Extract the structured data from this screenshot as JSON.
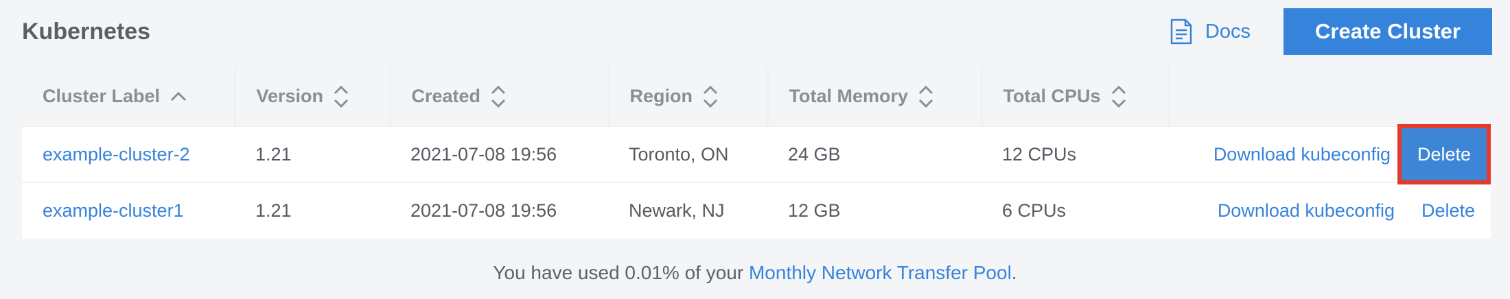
{
  "header": {
    "title": "Kubernetes",
    "docs_label": "Docs",
    "create_label": "Create Cluster"
  },
  "table": {
    "columns": [
      {
        "label": "Cluster Label",
        "sort": "ascending"
      },
      {
        "label": "Version",
        "sort": "none"
      },
      {
        "label": "Created",
        "sort": "none"
      },
      {
        "label": "Region",
        "sort": "none"
      },
      {
        "label": "Total Memory",
        "sort": "none"
      },
      {
        "label": "Total CPUs",
        "sort": "none"
      },
      {
        "label": "",
        "sort": "none"
      }
    ],
    "rows": [
      {
        "label": "example-cluster-2",
        "version": "1.21",
        "created": "2021-07-08 19:56",
        "region": "Toronto, ON",
        "memory": "24 GB",
        "cpus": "12 CPUs",
        "download": "Download kubeconfig",
        "delete": "Delete"
      },
      {
        "label": "example-cluster1",
        "version": "1.21",
        "created": "2021-07-08 19:56",
        "region": "Newark, NJ",
        "memory": "12 GB",
        "cpus": "6 CPUs",
        "download": "Download kubeconfig",
        "delete": "Delete"
      }
    ]
  },
  "footer": {
    "prefix": "You have used 0.01% of your ",
    "link": "Monthly Network Transfer Pool",
    "suffix": "."
  },
  "colors": {
    "accent": "#3683dc",
    "highlight": "#e53a28"
  }
}
